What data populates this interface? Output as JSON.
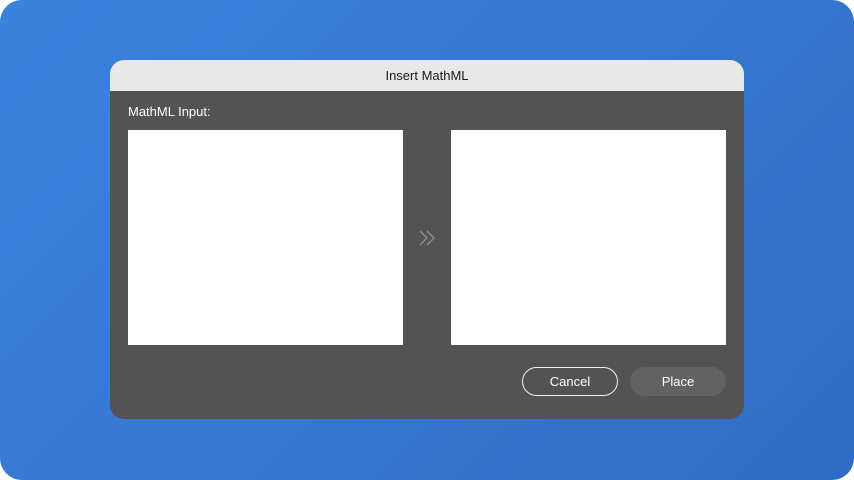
{
  "dialog": {
    "title": "Insert MathML",
    "input_label": "MathML Input:",
    "input_value": "",
    "preview_value": "",
    "cancel_label": "Cancel",
    "place_label": "Place",
    "arrow_icon": "double-chevron-right-icon"
  },
  "colors": {
    "background": "#3678d2",
    "dialog": "#535353",
    "titlebar": "#e8e8e8"
  }
}
